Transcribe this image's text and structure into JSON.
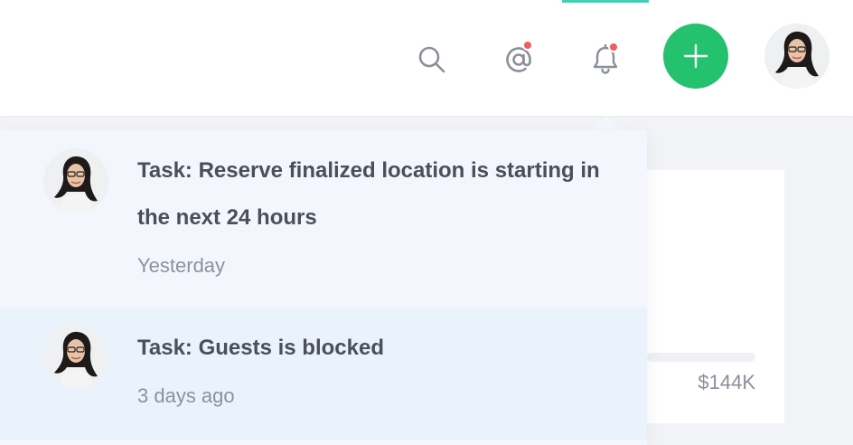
{
  "topbar": {
    "icons": {
      "search": "search-icon",
      "mentions": "at-sign-icon",
      "notifications": "bell-icon",
      "add": "plus-icon"
    },
    "mentions_badge": true,
    "notifications_badge": true
  },
  "colors": {
    "accent_green": "#24c26e",
    "active_tab_indicator": "#3fd0b5",
    "badge_red": "#f25c5c",
    "dropdown_bg": "#f3f7fd",
    "dropdown_highlight": "#eaf2fc"
  },
  "notifications": [
    {
      "title": "Task: Reserve finalized location is starting in the next 24 hours",
      "time": "Yesterday"
    },
    {
      "title": "Task: Guests is blocked",
      "time": "3 days ago"
    }
  ],
  "background_card": {
    "value": "$144K"
  }
}
